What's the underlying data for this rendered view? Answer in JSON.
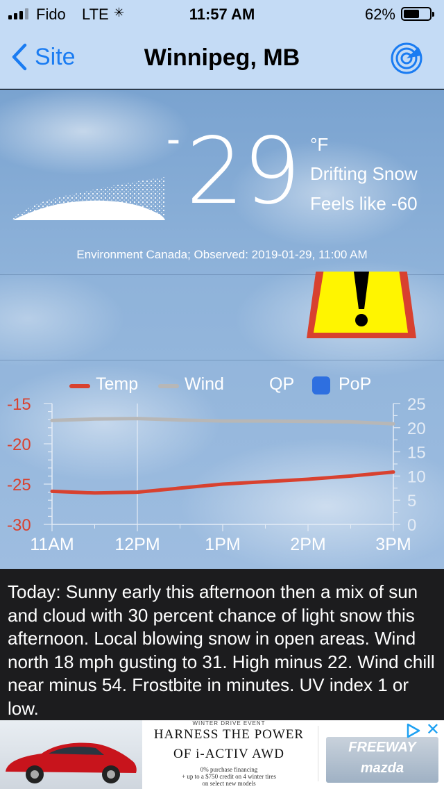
{
  "status_bar": {
    "carrier": "Fido",
    "network": "LTE",
    "time": "11:57 AM",
    "battery_pct": "62%",
    "battery_level": 0.62
  },
  "nav": {
    "back_label": "Site",
    "title": "Winnipeg, MB",
    "radar_icon": "radar-icon"
  },
  "current": {
    "temp_sign": "-",
    "temp_value": "29",
    "unit": "°F",
    "condition": "Drifting Snow",
    "feels_like": "Feels like -60",
    "condition_icon": "drifting-snow-icon",
    "observed": "Environment Canada; Observed: 2019-01-29, 11:00 AM",
    "warning_icon": "warning-icon"
  },
  "legend": {
    "temp": "Temp",
    "wind": "Wind",
    "qp": "QP",
    "pop": "PoP"
  },
  "colors": {
    "temp": "#d8412f",
    "wind": "#b7b7b7",
    "pop": "#2e6fe0",
    "link": "#1a7cf2"
  },
  "chart_data": {
    "type": "line",
    "categories": [
      "11AM",
      "12PM",
      "1PM",
      "2PM",
      "3PM"
    ],
    "x": [
      11,
      11.5,
      12,
      12.5,
      13,
      13.5,
      14,
      14.5,
      15
    ],
    "series": [
      {
        "name": "Temp",
        "axis": "left",
        "values": [
          -25.9,
          -26.1,
          -26.0,
          -25.5,
          -25.0,
          -24.7,
          -24.4,
          -24.0,
          -23.5
        ]
      },
      {
        "name": "Wind",
        "axis": "right",
        "values": [
          21.5,
          21.8,
          21.9,
          21.6,
          21.4,
          21.4,
          21.3,
          21.2,
          20.8
        ]
      }
    ],
    "left_axis": {
      "ylim": [
        -30,
        -15
      ],
      "ticks": [
        "-15",
        "-20",
        "-25",
        "-30"
      ],
      "tick_values": [
        -15,
        -20,
        -25,
        -30
      ]
    },
    "right_axis": {
      "ylim": [
        0,
        25
      ],
      "ticks": [
        "25",
        "20",
        "15",
        "10",
        "5",
        "0"
      ],
      "tick_values": [
        25,
        20,
        15,
        10,
        5,
        0
      ]
    },
    "grid": false
  },
  "forecast_text": "Today:  Sunny early this afternoon then a mix of sun and cloud with 30 percent chance of light snow this afternoon. Local blowing snow in open areas. Wind north 18 mph gusting to 31. High minus 22. Wind chill near minus 54. Frostbite in minutes. UV index 1 or low.",
  "ad": {
    "event": "WINTER DRIVE EVENT",
    "headline": "HARNESS THE POWER",
    "sub": "OF i-ACTIV AWD",
    "fine1": "0% purchase financing",
    "fine2": "+ up to a $750 credit on 4 winter tires",
    "fine3": "on select new models",
    "dealer_line1": "FREEWAY",
    "dealer_line2": "mazda",
    "close": "✕"
  }
}
